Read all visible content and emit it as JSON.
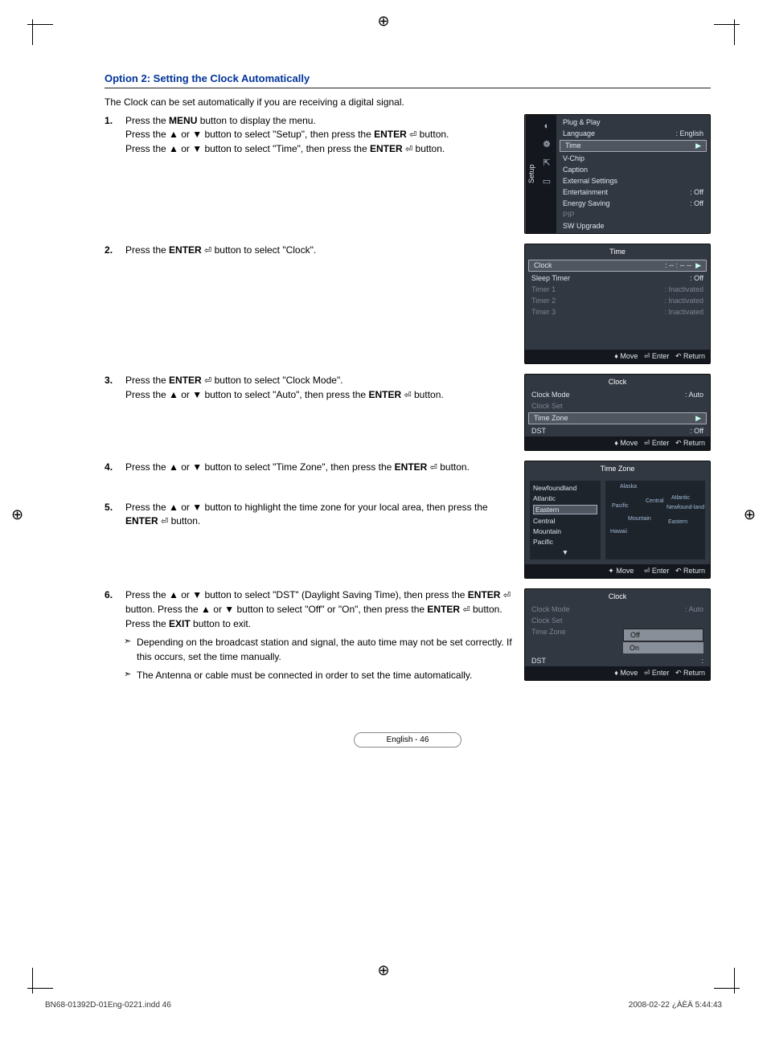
{
  "heading": "Option 2: Setting the Clock Automatically",
  "intro": "The Clock can be set automatically if you are receiving a digital signal.",
  "steps": {
    "s1a": "Press the ",
    "s1b": " button to display the menu.",
    "s1c": "Press the ▲ or ▼ button to select \"Setup\", then press the ",
    "s1d": " button.",
    "s1e": "Press the ▲ or ▼ button to select \"Time\", then press the ",
    "s1f": " button.",
    "s2a": "Press the ",
    "s2b": " button to select \"Clock\".",
    "s3a": "Press the ",
    "s3b": " button to select \"Clock Mode\".",
    "s3c": "Press the ▲ or ▼ button to select \"Auto\", then press the ",
    "s3d": " button.",
    "s4a": "Press the ▲ or ▼ button to select \"Time Zone\", then press the ",
    "s4b": " button.",
    "s5a": "Press the ▲ or ▼ button to highlight the time zone for your local area, then press the ",
    "s5b": " button.",
    "s6a": "Press the ▲ or ▼ button to select \"DST\" (Daylight Saving Time), then press the ",
    "s6b": " button. Press the ▲ or ▼ button to select \"Off\" or \"On\", then press the ",
    "s6c": " button.",
    "s6d": "Press the ",
    "s6e": " button to exit.",
    "note1": "Depending on the broadcast station and signal, the auto time may not be set correctly. If this occurs, set the time manually.",
    "note2": "The Antenna or cable must be connected in order to set the time automatically."
  },
  "keys": {
    "menu": "MENU",
    "enter": "ENTER",
    "exit": "EXIT",
    "enter_icon": "⏎"
  },
  "setup_panel": {
    "side": "Setup",
    "items": {
      "plugplay": "Plug & Play",
      "language": "Language",
      "language_val": ": English",
      "time": "Time",
      "vchip": "V-Chip",
      "caption": "Caption",
      "external": "External Settings",
      "entertainment": "Entertainment",
      "entertainment_val": ": Off",
      "energy": "Energy Saving",
      "energy_val": ": Off",
      "pip": "PIP",
      "sw": "SW Upgrade"
    },
    "play": "▶"
  },
  "time_panel": {
    "title": "Time",
    "clock": "Clock",
    "clock_val": ": -- : -- --",
    "sleep": "Sleep Timer",
    "sleep_val": ": Off",
    "t1": "Timer 1",
    "t2": "Timer 2",
    "t3": "Timer 3",
    "inact": ": Inactivated",
    "play": "▶"
  },
  "clock_panel": {
    "title": "Clock",
    "mode": "Clock Mode",
    "mode_val": ": Auto",
    "set": "Clock Set",
    "tz": "Time Zone",
    "dst": "DST",
    "dst_val": ": Off",
    "play": "▶"
  },
  "tz_panel": {
    "title": "Time Zone",
    "list": [
      "Newfoundland",
      "Atlantic",
      "Eastern",
      "Central",
      "Mountain",
      "Pacific"
    ],
    "map_labels": {
      "alaska": "Alaska",
      "pacific": "Pacific",
      "mountain": "Mountain",
      "central": "Central",
      "eastern": "Eastern",
      "atlantic": "Atlantic",
      "newfoundland": "Newfound-land",
      "hawaii": "Hawaii"
    },
    "down": "▼"
  },
  "dst_panel": {
    "title": "Clock",
    "mode": "Clock Mode",
    "mode_val": ": Auto",
    "set": "Clock Set",
    "tz": "Time Zone",
    "dst": "DST",
    "opt_off": "Off",
    "opt_on": "On"
  },
  "footer_hints": {
    "move": "♦ Move",
    "move_ud": "✦ Move",
    "enter": "⏎ Enter",
    "return": "↶ Return"
  },
  "page_num": "English - 46",
  "meta": {
    "left": "BN68-01392D-01Eng-0221.indd   46",
    "right": "2008-02-22   ¿ÀÈÄ 5:44:43"
  }
}
